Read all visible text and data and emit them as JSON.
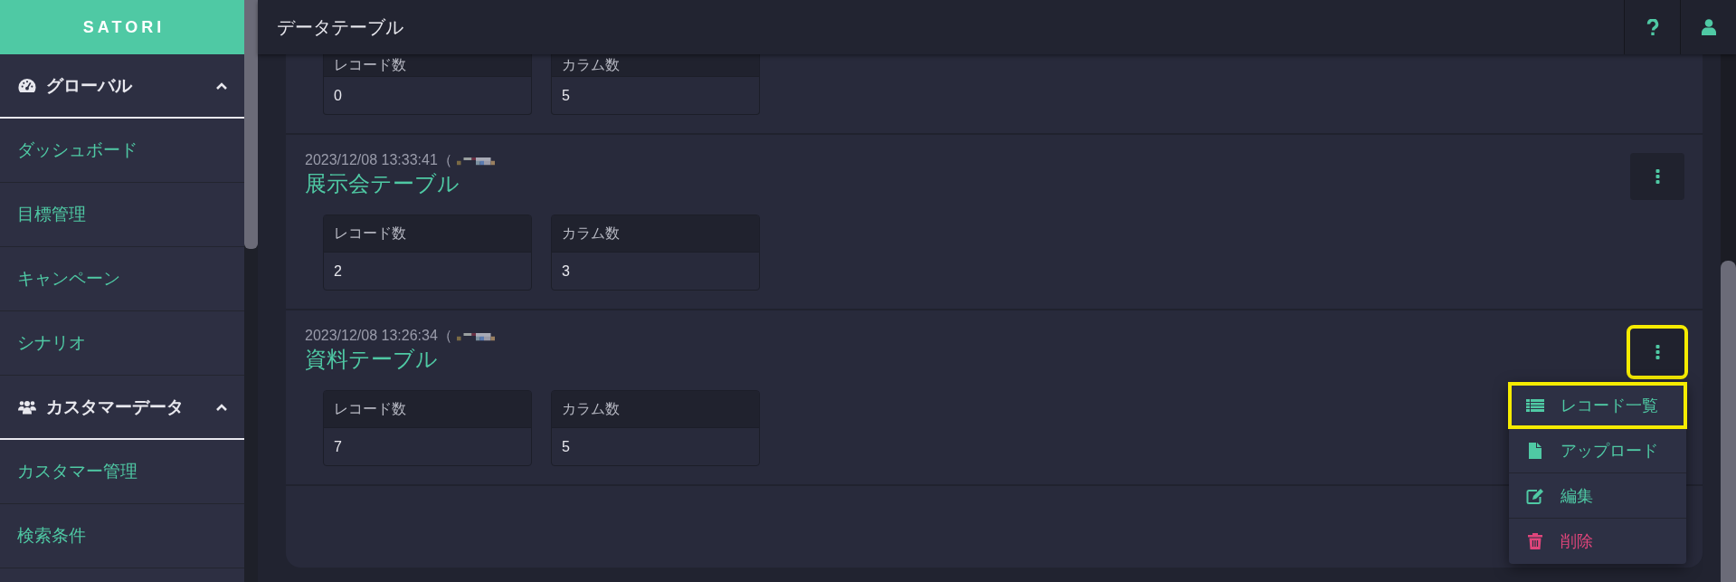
{
  "brand": "SATORI",
  "header": {
    "title": "データテーブル"
  },
  "sidebar": {
    "groups": [
      {
        "label": "グローバル",
        "expanded": true,
        "items": [
          {
            "label": "ダッシュボード"
          },
          {
            "label": "目標管理"
          },
          {
            "label": "キャンペーン"
          },
          {
            "label": "シナリオ"
          }
        ]
      },
      {
        "label": "カスタマーデータ",
        "expanded": true,
        "items": [
          {
            "label": "カスタマー管理"
          },
          {
            "label": "検索条件"
          }
        ]
      }
    ]
  },
  "tables": [
    {
      "stats": [
        {
          "label": "レコード数",
          "value": "0"
        },
        {
          "label": "カラム数",
          "value": "5"
        }
      ]
    },
    {
      "date": "2023/12/08 13:33:41（",
      "title": "展示会テーブル",
      "stats": [
        {
          "label": "レコード数",
          "value": "2"
        },
        {
          "label": "カラム数",
          "value": "3"
        }
      ],
      "menu_button": {
        "highlighted": false
      }
    },
    {
      "date": "2023/12/08 13:26:34（",
      "title": "資料テーブル",
      "stats": [
        {
          "label": "レコード数",
          "value": "7"
        },
        {
          "label": "カラム数",
          "value": "5"
        }
      ],
      "menu_button": {
        "highlighted": true
      },
      "menu": {
        "items": [
          {
            "label": "レコード一覧",
            "kind": "list",
            "highlighted": true
          },
          {
            "label": "アップロード",
            "kind": "upload",
            "highlighted": false
          },
          {
            "label": "編集",
            "kind": "edit",
            "highlighted": false
          },
          {
            "label": "削除",
            "kind": "delete",
            "highlighted": false
          }
        ]
      }
    }
  ]
}
